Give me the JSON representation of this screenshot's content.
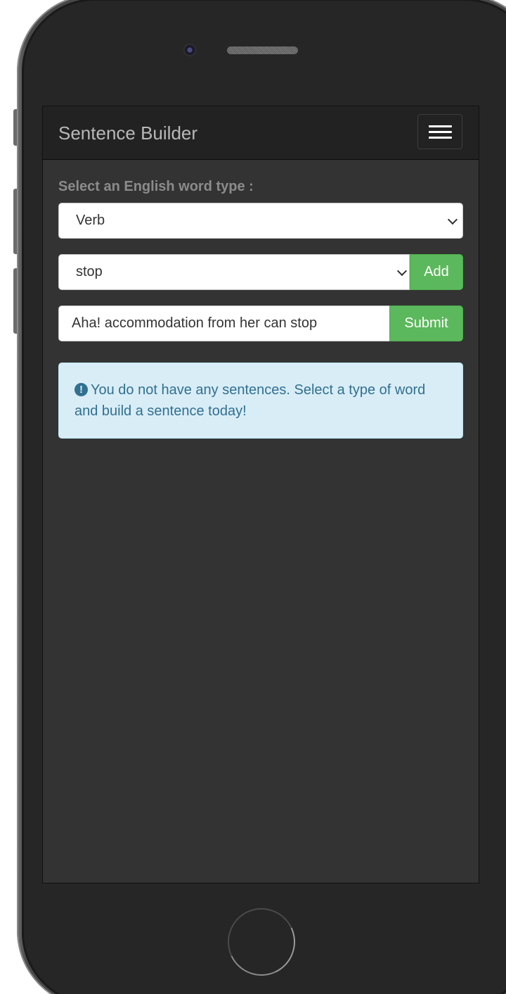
{
  "app": {
    "brand": "Sentence Builder",
    "menu_icon": "hamburger-menu-icon"
  },
  "form": {
    "word_type_label": "Select an English word type :",
    "word_type_value": "Verb",
    "word_value": "stop",
    "add_label": "Add",
    "sentence_value": "Aha! accommodation from her can stop",
    "submit_label": "Submit"
  },
  "alert": {
    "icon": "exclamation-circle-icon",
    "message": "You do not have any sentences. Select a type of word and build a sentence today!"
  },
  "colors": {
    "navbar": "#222222",
    "screen_bg": "#333333",
    "button_green": "#5cb85c",
    "alert_bg": "#d9edf7",
    "alert_text": "#31708f"
  }
}
